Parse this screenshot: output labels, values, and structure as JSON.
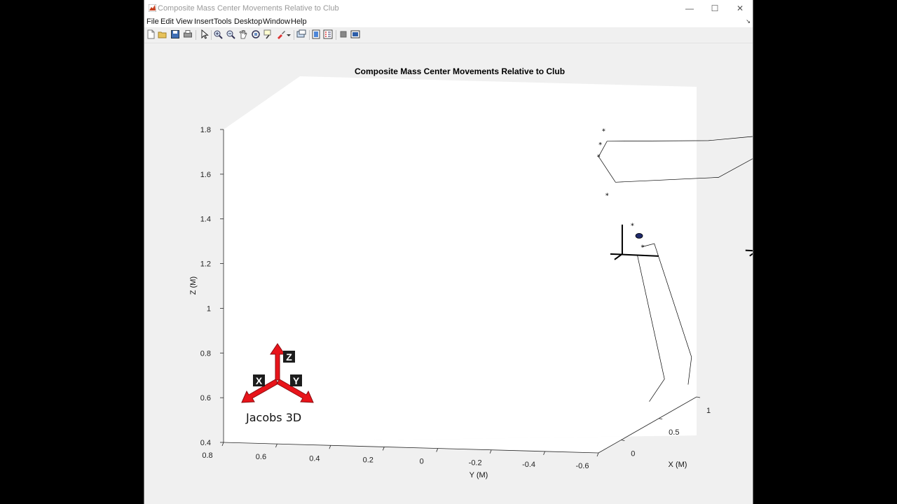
{
  "window": {
    "title": "Composite Mass Center Movements Relative to Club",
    "controls": {
      "minimize": "—",
      "maximize": "☐",
      "close": "✕"
    }
  },
  "menu": {
    "items": [
      "File",
      "Edit",
      "View",
      "Insert",
      "Tools",
      "Desktop",
      "Window",
      "Help"
    ],
    "dock_arrow": "↘"
  },
  "toolbar": {
    "icons": [
      "new-figure-icon",
      "open-file-icon",
      "save-icon",
      "print-icon",
      "select-arrow-icon",
      "zoom-in-icon",
      "zoom-out-icon",
      "pan-hand-icon",
      "rotate-3d-icon",
      "data-cursor-icon",
      "brush-icon",
      "link-plot-icon",
      "colorbar-icon",
      "legend-icon",
      "hide-tools-icon",
      "show-tools-icon"
    ]
  },
  "logo": {
    "label": "Jacobs 3D",
    "letters": [
      "Z",
      "X",
      "Y"
    ],
    "color": "#e8141a"
  },
  "chart_data": {
    "type": "line",
    "title": "Composite Mass Center Movements Relative to Club",
    "zlabel": "Z (M)",
    "ylabel": "Y (M)",
    "xlabel": "X (M)",
    "z_ticks": [
      "0.4",
      "0.6",
      "0.8",
      "1",
      "1.2",
      "1.4",
      "1.6",
      "1.8"
    ],
    "y_ticks": [
      "0.8",
      "0.6",
      "0.4",
      "0.2",
      "0",
      "-0.2",
      "-0.4",
      "-0.6"
    ],
    "x_ticks": [
      "0",
      "0.5",
      "1"
    ],
    "zlim": [
      0.4,
      1.8
    ],
    "ylim": [
      0.8,
      -0.6
    ],
    "xlim": [
      -0.3,
      1
    ],
    "grid": false,
    "view": "3d",
    "series": [
      {
        "marker": "*",
        "points": [
          {
            "y": -0.325,
            "z": 1.655
          },
          {
            "y": -0.315,
            "z": 1.6
          },
          {
            "y": -0.31,
            "z": 1.55
          },
          {
            "y": -0.335,
            "z": 1.39
          },
          {
            "y": -0.41,
            "z": 1.26
          },
          {
            "y": -0.44,
            "z": 1.17
          }
        ]
      },
      {
        "marker": "o",
        "points": [
          {
            "y": -0.43,
            "z": 1.215
          }
        ]
      },
      {
        "style": "line",
        "segments": [
          [
            {
              "y": -0.31,
              "z": 1.55
            },
            {
              "y": -0.335,
              "z": 1.61
            },
            {
              "y": -0.635,
              "z": 1.58
            },
            {
              "y": -0.88,
              "z": 1.585
            }
          ],
          [
            {
              "y": -0.31,
              "z": 1.55
            },
            {
              "y": -0.36,
              "z": 1.44
            },
            {
              "y": -0.665,
              "z": 1.43
            },
            {
              "y": -0.87,
              "z": 1.56
            }
          ],
          [
            {
              "y": -0.44,
              "z": 1.17
            },
            {
              "y": -0.475,
              "z": 1.18
            },
            {
              "y": -0.585,
              "z": 0.715
            },
            {
              "y": -0.575,
              "z": 0.605
            }
          ],
          [
            {
              "y": -0.425,
              "z": 1.135
            },
            {
              "y": -0.505,
              "z": 0.63
            },
            {
              "y": -0.46,
              "z": 0.54
            }
          ]
        ]
      },
      {
        "style": "axes-triad",
        "origins": [
          {
            "y": -0.38,
            "z": 1.145
          },
          {
            "y": -0.78,
            "z": 1.13
          }
        ]
      }
    ]
  }
}
